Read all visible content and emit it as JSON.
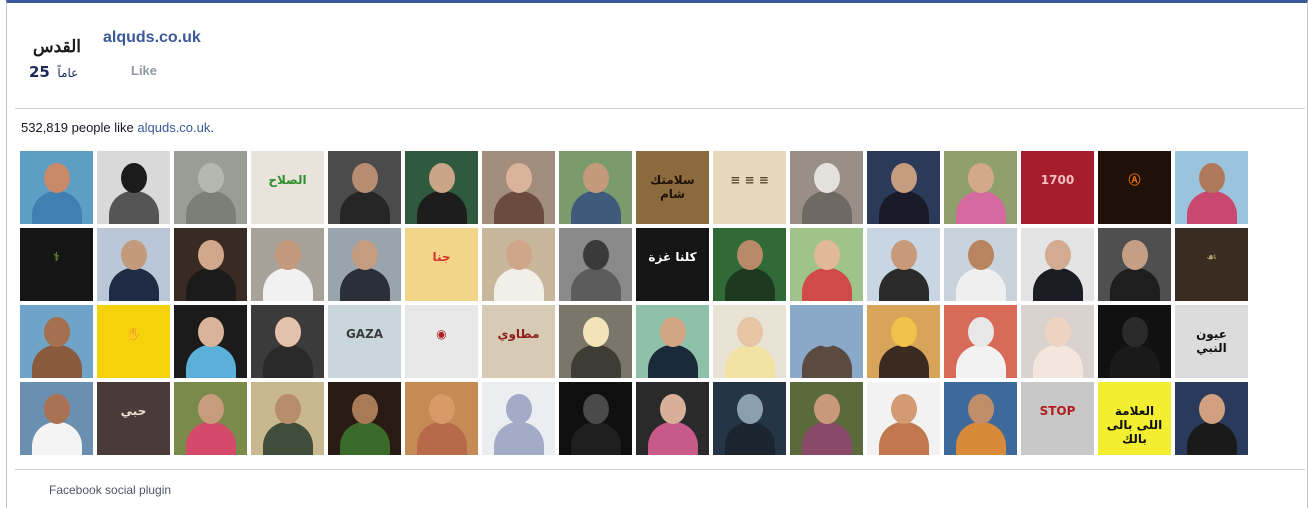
{
  "page": {
    "name": "alquds.co.uk",
    "like_label": "Like",
    "logo_text": "القدس",
    "logo_number": "25",
    "logo_years": "عاماً"
  },
  "summary": {
    "count": "532,819",
    "text": " people like ",
    "page_link": "alquds.co.uk",
    "suffix": "."
  },
  "faces": [
    {
      "bg": "#5d9fc4",
      "hd": "#c98a6a",
      "bd": "#3f7fb2"
    },
    {
      "bg": "#d9d9d9",
      "hd": "#1b1b1b",
      "bd": "#555555"
    },
    {
      "bg": "#9a9d95",
      "hd": "#b5b8af",
      "bd": "#7c7f78"
    },
    {
      "bg": "#e8e4dc",
      "hd": "#c79d80",
      "bd": "#f2f2f2",
      "tx": "الصلاح",
      "tc": "#2f8f2f"
    },
    {
      "bg": "#4b4b4b",
      "hd": "#b88c70",
      "bd": "#262626"
    },
    {
      "bg": "#2f5a3e",
      "hd": "#c9a487",
      "bd": "#1d1d1d"
    },
    {
      "bg": "#a38e7d",
      "hd": "#d9b39a",
      "bd": "#6b4b3d"
    },
    {
      "bg": "#7c9b6d",
      "hd": "#c49a7c",
      "bd": "#3f5a7a"
    },
    {
      "bg": "#8b6a3d",
      "hd": "#8b6a3d",
      "bd": "#8b6a3d",
      "tx": "سلامتك شام",
      "tc": "#1f1208"
    },
    {
      "bg": "#e6d9bd",
      "hd": "#e6d9bd",
      "bd": "#e6d9bd",
      "tx": "≡ ≡ ≡",
      "tc": "#5a4a30"
    },
    {
      "bg": "#9a8f86",
      "hd": "#e4e0dc",
      "bd": "#6f6963"
    },
    {
      "bg": "#2b3a59",
      "hd": "#c69c7e",
      "bd": "#1a1a2b"
    },
    {
      "bg": "#8fa06d",
      "hd": "#d4a98b",
      "bd": "#d46aa0"
    },
    {
      "bg": "#a61c2c",
      "hd": "#a61c2c",
      "bd": "#a61c2c",
      "tx": "1700",
      "tc": "#f0c0c0"
    },
    {
      "bg": "#1f1108",
      "hd": "#1f1108",
      "bd": "#1f1108",
      "tx": "Ⓐ",
      "tc": "#e06a10"
    },
    {
      "bg": "#9bc3dc",
      "hd": "#b07a5a",
      "bd": "#c8486f"
    },
    {
      "bg": "#151515",
      "hd": "#151515",
      "bd": "#151515",
      "tx": "⚕",
      "tc": "#8ac43f"
    },
    {
      "bg": "#b9c7d8",
      "hd": "#c49a7c",
      "bd": "#1f2a44"
    },
    {
      "bg": "#3a2a24",
      "hd": "#d1a88c",
      "bd": "#1b1b1b"
    },
    {
      "bg": "#a7a39a",
      "hd": "#c39a7e",
      "bd": "#f1f1f1"
    },
    {
      "bg": "#9aa4ad",
      "hd": "#c49c80",
      "bd": "#2a2f3a"
    },
    {
      "bg": "#f3d58a",
      "hd": "#f3d58a",
      "bd": "#f3d58a",
      "tx": "جنا",
      "tc": "#d4312b"
    },
    {
      "bg": "#c9b79c",
      "hd": "#cfa68a",
      "bd": "#f2efe8"
    },
    {
      "bg": "#8a8a8a",
      "hd": "#3a3a3a",
      "bd": "#5c5c5c"
    },
    {
      "bg": "#151515",
      "hd": "#151515",
      "bd": "#151515",
      "tx": "كلنا غزة",
      "tc": "#ffffff"
    },
    {
      "bg": "#2f6a37",
      "hd": "#b98a68",
      "bd": "#1d3a20"
    },
    {
      "bg": "#9fc38a",
      "hd": "#e1b89a",
      "bd": "#d14a4a"
    },
    {
      "bg": "#c7d6e2",
      "hd": "#c99a7a",
      "bd": "#2a2a2a"
    },
    {
      "bg": "#c9d3dc",
      "hd": "#b98560",
      "bd": "#efefef"
    },
    {
      "bg": "#e4e4e4",
      "hd": "#d2ab90",
      "bd": "#1c1c24"
    },
    {
      "bg": "#4f4f4f",
      "hd": "#c59f84",
      "bd": "#1e1e1e"
    },
    {
      "bg": "#3a2c20",
      "hd": "#3a2c20",
      "bd": "#3a2c20",
      "tx": "☙",
      "tc": "#b49a70"
    },
    {
      "bg": "#6fa4c8",
      "hd": "#a4704f",
      "bd": "#8a5a3d"
    },
    {
      "bg": "#f5d20b",
      "hd": "#f5d20b",
      "bd": "#f5d20b",
      "tx": "✋",
      "tc": "#111111"
    },
    {
      "bg": "#1b1b1b",
      "hd": "#d9b49a",
      "bd": "#5ab0d8"
    },
    {
      "bg": "#3b3b3b",
      "hd": "#e2c2aa",
      "bd": "#2a2a2a"
    },
    {
      "bg": "#c9d7dd",
      "hd": "#d8b396",
      "bd": "#3e8e4a",
      "tx": "GAZA",
      "tc": "#3b3b3b"
    },
    {
      "bg": "#e8e8e8",
      "hd": "#e8e8e8",
      "bd": "#e8e8e8",
      "tx": "◉",
      "tc": "#b01f1f"
    },
    {
      "bg": "#d8cbb5",
      "hd": "#d8cbb5",
      "bd": "#d8cbb5",
      "tx": "مطاوي",
      "tc": "#8f1e1e"
    },
    {
      "bg": "#7a776a",
      "hd": "#f3e4b8",
      "bd": "#3e3c34"
    },
    {
      "bg": "#8fc0a8",
      "hd": "#d3a683",
      "bd": "#1a2a3a"
    },
    {
      "bg": "#e9e3d6",
      "hd": "#e7c4a4",
      "bd": "#f2e3a5"
    },
    {
      "bg": "#8aa8c8",
      "hd": "#8aa8c8",
      "bd": "#5a4a40"
    },
    {
      "bg": "#d8a45a",
      "hd": "#f2c34a",
      "bd": "#3a2a20"
    },
    {
      "bg": "#d86a5a",
      "hd": "#e7e7e7",
      "bd": "#f2f2f2"
    },
    {
      "bg": "#d9d2cf",
      "hd": "#efd3c2",
      "bd": "#f4e6dd"
    },
    {
      "bg": "#111111",
      "hd": "#2a2a2a",
      "bd": "#1a1a1a"
    },
    {
      "bg": "#dcdcdc",
      "hd": "#dcdcdc",
      "bd": "#dcdcdc",
      "tx": "عيون النبي",
      "tc": "#111111"
    },
    {
      "bg": "#6a8fb0",
      "hd": "#a97252",
      "bd": "#f4f4f4"
    },
    {
      "bg": "#4a3a3a",
      "hd": "#4a3a3a",
      "bd": "#4a3a3a",
      "tx": "حبي",
      "tc": "#f0e0d0"
    },
    {
      "bg": "#7a8a4a",
      "hd": "#c79c7c",
      "bd": "#d44a6a"
    },
    {
      "bg": "#c9b88d",
      "hd": "#b98c6a",
      "bd": "#3f4d3a"
    },
    {
      "bg": "#2a1a14",
      "hd": "#a97a56",
      "bd": "#3a6a2a"
    },
    {
      "bg": "#c68a55",
      "hd": "#d79a68",
      "bd": "#b76a4a"
    },
    {
      "bg": "#ecedf1",
      "hd": "#a3acc6",
      "bd": "#a3acc6"
    },
    {
      "bg": "#0f0f0f",
      "hd": "#4a4a4a",
      "bd": "#1e1e1e"
    },
    {
      "bg": "#2a2a2a",
      "hd": "#d8b09a",
      "bd": "#c85a8a"
    },
    {
      "bg": "#253545",
      "hd": "#8aa0b0",
      "bd": "#1a2530"
    },
    {
      "bg": "#5a6a3a",
      "hd": "#c99a7a",
      "bd": "#8a4a6a"
    },
    {
      "bg": "#f2f2f2",
      "hd": "#d49a72",
      "bd": "#c2784e"
    },
    {
      "bg": "#3d6a9a",
      "hd": "#c08f6a",
      "bd": "#d88a3a"
    },
    {
      "bg": "#c8c8c8",
      "hd": "#e8e8e8",
      "bd": "#1a1a1a",
      "tx": "STOP",
      "tc": "#b01f1f"
    },
    {
      "bg": "#f3ee2f",
      "hd": "#f3ee2f",
      "bd": "#f3ee2f",
      "tx": "العلامة اللى بالى بالك",
      "tc": "#111111"
    },
    {
      "bg": "#2a3a5a",
      "hd": "#d0a080",
      "bd": "#1a1a1a"
    }
  ],
  "footer": {
    "text": "Facebook social plugin"
  }
}
